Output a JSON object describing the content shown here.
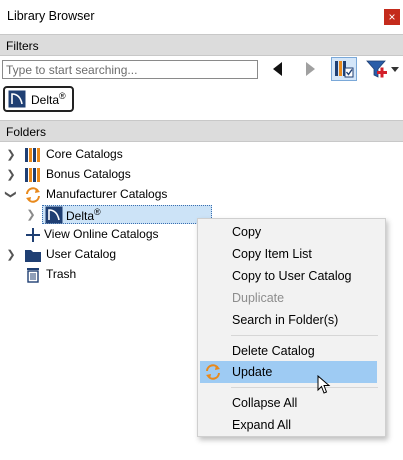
{
  "window": {
    "title": "Library Browser",
    "close_glyph": "×"
  },
  "filters": {
    "header": "Filters",
    "search_placeholder": "Type to start searching...",
    "search_value": "",
    "tools": [
      "back-arrow-icon",
      "forward-arrow-icon",
      "catalog-filter-icon",
      "funnel-add-icon",
      "dropdown-caret-icon"
    ],
    "active_chip": {
      "label": "Delta",
      "mark": "®",
      "icon": "delta-catalog-icon"
    }
  },
  "folders": {
    "header": "Folders",
    "items": [
      {
        "label": "Core Catalogs",
        "icon": "books-icon",
        "expander": "collapsed"
      },
      {
        "label": "Bonus Catalogs",
        "icon": "books-icon",
        "expander": "collapsed"
      },
      {
        "label": "Manufacturer Catalogs",
        "icon": "sync-arrows-icon",
        "expander": "expanded"
      },
      {
        "label": "Delta",
        "mark": "®",
        "icon": "delta-catalog-icon",
        "expander": "collapsed",
        "selected": true
      },
      {
        "label": "View Online Catalogs",
        "icon": "plus-icon",
        "expander": "none"
      },
      {
        "label": "User Catalog",
        "icon": "folder-icon",
        "expander": "collapsed"
      },
      {
        "label": "Trash",
        "icon": "trash-icon",
        "expander": "none"
      }
    ]
  },
  "context_menu": {
    "items": [
      {
        "label": "Copy",
        "enabled": true
      },
      {
        "label": "Copy Item List",
        "enabled": true
      },
      {
        "label": "Copy to User Catalog",
        "enabled": true
      },
      {
        "label": "Duplicate",
        "enabled": false
      },
      {
        "label": "Search in Folder(s)",
        "enabled": true
      },
      {
        "label": "Delete Catalog",
        "enabled": true
      },
      {
        "label": "Update",
        "enabled": true,
        "hovered": true,
        "icon": "sync-arrows-icon"
      },
      {
        "label": "Collapse All",
        "enabled": true
      },
      {
        "label": "Expand All",
        "enabled": true
      }
    ]
  },
  "colors": {
    "header_bg": "#dcdcdc",
    "close_red": "#c42b1c",
    "selection_blue": "#cce3f7",
    "menu_hover": "#9ecbf3",
    "sync_orange": "#e8891c",
    "folder_navy": "#1f3f73"
  }
}
